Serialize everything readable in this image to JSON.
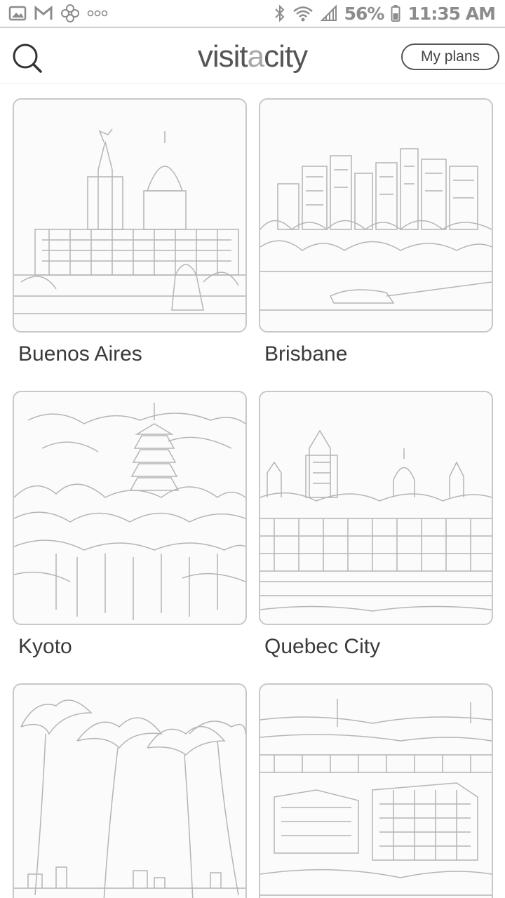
{
  "status_bar": {
    "battery": "56%",
    "time": "11:35 AM",
    "icons": [
      "gallery-icon",
      "gmail-icon",
      "flower-icon",
      "more-icon",
      "bluetooth-icon",
      "wifi-icon",
      "signal-icon",
      "battery-icon"
    ]
  },
  "header": {
    "logo_pre": "visit",
    "logo_accent": "a",
    "logo_post": "city",
    "my_plans_label": "My plans",
    "search_icon": "search-icon"
  },
  "cities": [
    {
      "name": "Buenos Aires"
    },
    {
      "name": "Brisbane"
    },
    {
      "name": "Kyoto"
    },
    {
      "name": "Quebec City"
    },
    {
      "name": ""
    },
    {
      "name": ""
    }
  ]
}
